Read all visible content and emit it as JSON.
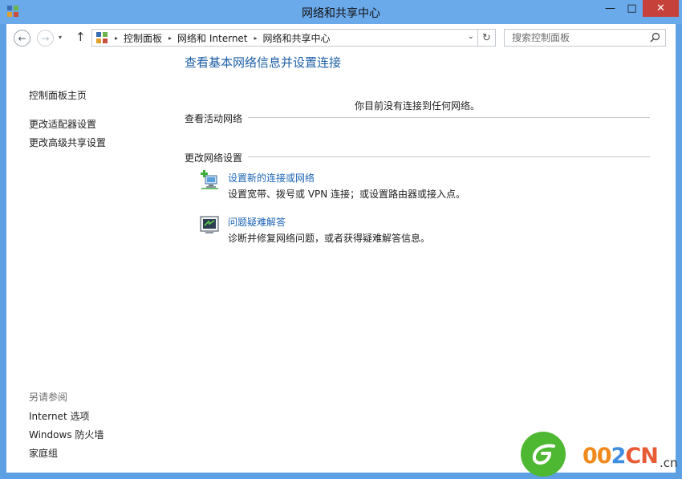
{
  "window": {
    "title": "网络和共享中心",
    "controls": {
      "minimize": "—",
      "maximize": "□",
      "close": "✕"
    }
  },
  "navigation": {
    "back_icon": "←",
    "forward_icon": "→",
    "recent_icon": "▾",
    "up_icon": "↑",
    "breadcrumb": [
      "控制面板",
      "网络和 Internet",
      "网络和共享中心"
    ],
    "breadcrumb_separator": "▸",
    "address_dropdown_icon": "⌄",
    "refresh_icon": "↻",
    "search_placeholder": "搜索控制面板"
  },
  "sidebar": {
    "home": "控制面板主页",
    "links": [
      "更改适配器设置",
      "更改高级共享设置"
    ],
    "see_also_heading": "另请参阅",
    "see_also": [
      "Internet 选项",
      "Windows 防火墙",
      "家庭组"
    ]
  },
  "main": {
    "title": "查看基本网络信息并设置连接",
    "active_networks_heading": "查看活动网络",
    "no_network_text": "你目前没有连接到任何网络。",
    "change_settings_heading": "更改网络设置",
    "tasks": [
      {
        "icon": "network-setup-icon",
        "link": "设置新的连接或网络",
        "description": "设置宽带、拨号或 VPN 连接；或设置路由器或接入点。"
      },
      {
        "icon": "troubleshoot-icon",
        "link": "问题疑难解答",
        "description": "诊断并修复网络问题，或者获得疑难解答信息。"
      }
    ]
  },
  "watermark": {
    "part1": "00",
    "part2": "2",
    "part3": "CN",
    "suffix": ".cn"
  },
  "colors": {
    "title_bar": "#6aa9ea",
    "close_button": "#c7413b",
    "heading_blue": "#1e5fa5",
    "link_blue": "#1c64b5"
  }
}
